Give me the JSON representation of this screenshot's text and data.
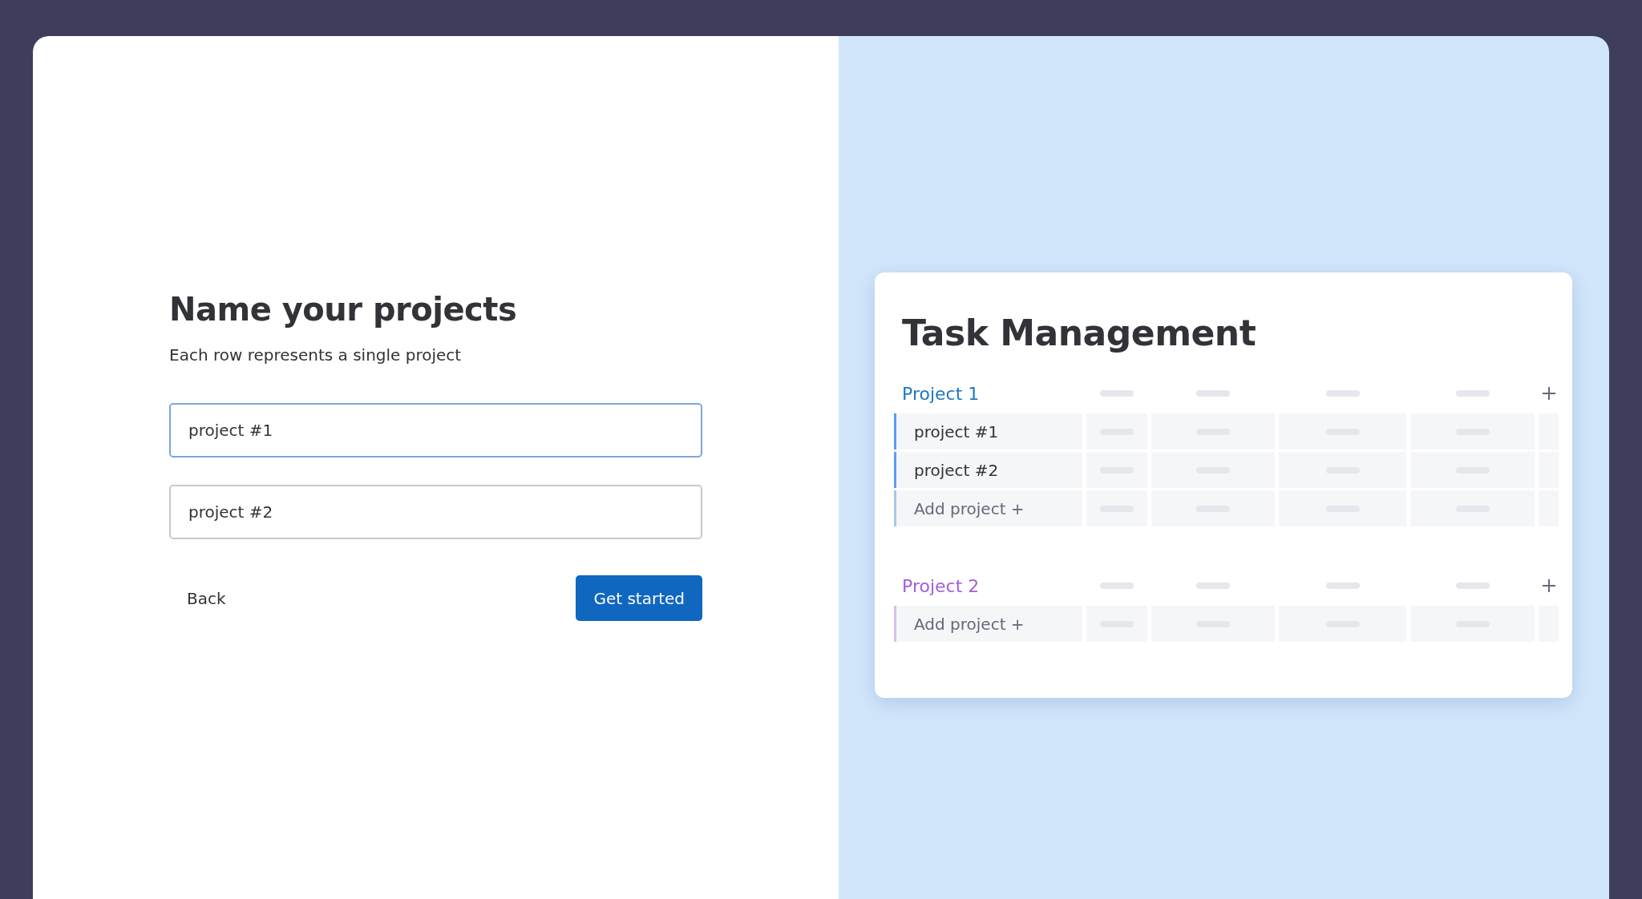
{
  "form": {
    "title": "Name your projects",
    "subtitle": "Each row represents a single project",
    "inputs": [
      {
        "value": "project #1",
        "focused": true
      },
      {
        "value": "project #2",
        "focused": false
      }
    ],
    "back_button": "Back",
    "primary_button": "Get started"
  },
  "preview": {
    "title": "Task Management",
    "groups": [
      {
        "title": "Project 1",
        "color": "#1f76c2",
        "rows": [
          {
            "kind": "item",
            "label": "project #1"
          },
          {
            "kind": "item",
            "label": "project #2"
          },
          {
            "kind": "add",
            "label": "Add project +"
          }
        ]
      },
      {
        "title": "Project 2",
        "color": "#a25ddc",
        "rows": [
          {
            "kind": "add",
            "label": "Add project +"
          }
        ]
      }
    ]
  }
}
